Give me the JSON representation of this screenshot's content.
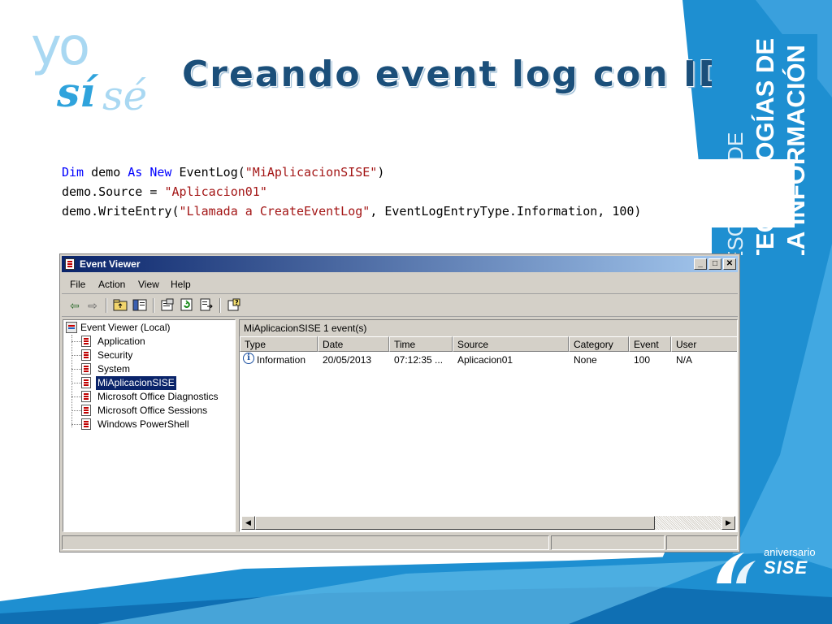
{
  "slide": {
    "title": "Creando event log con ID",
    "logo": {
      "yo": "yo",
      "si": "sí",
      "se": "sé"
    },
    "side_text": {
      "line1": "ESCUELA DE",
      "line2": "TECNOLOGÍAS DE",
      "line3": "LA INFORMACIÓN"
    },
    "anniversary": {
      "top": "aniversario",
      "bottom": "SISE"
    },
    "colors": {
      "title": "#1b4f7a",
      "accent": "#1e8fd1",
      "band_light": "#8fd0f5"
    }
  },
  "code": {
    "line1": {
      "kw1": "Dim",
      "t1": " demo ",
      "kw2": "As",
      "sp": " ",
      "kw3": "New",
      "t2": " EventLog(",
      "s1": "\"MiAplicacionSISE\"",
      "t3": ")"
    },
    "line2": {
      "t1": "demo.Source = ",
      "s1": "\"Aplicacion01\""
    },
    "line3": {
      "t1": "demo.WriteEntry(",
      "s1": "\"Llamada a CreateEventLog\"",
      "t2": ", EventLogEntryType.Information, 100)"
    }
  },
  "window": {
    "title": "Event Viewer",
    "controls": {
      "minimize": "_",
      "maximize": "□",
      "close": "✕"
    },
    "menu": [
      "File",
      "Action",
      "View",
      "Help"
    ],
    "toolbar_icons": [
      "back-icon",
      "forward-icon",
      "up-folder-icon",
      "show-tree-icon",
      "properties-icon",
      "refresh-icon",
      "export-icon",
      "help-icon"
    ],
    "tree": {
      "root": "Event Viewer (Local)",
      "items": [
        {
          "label": "Application"
        },
        {
          "label": "Security"
        },
        {
          "label": "System"
        },
        {
          "label": "MiAplicacionSISE",
          "selected": true
        },
        {
          "label": "Microsoft Office Diagnostics"
        },
        {
          "label": "Microsoft Office Sessions"
        },
        {
          "label": "Windows PowerShell"
        }
      ]
    },
    "list": {
      "log_name": "MiAplicacionSISE",
      "event_count": "1 event(s)",
      "columns": [
        "Type",
        "Date",
        "Time",
        "Source",
        "Category",
        "Event",
        "User"
      ],
      "rows": [
        {
          "type": "Information",
          "date": "20/05/2013",
          "time": "07:12:35 ...",
          "source": "Aplicacion01",
          "category": "None",
          "event": "100",
          "user": "N/A"
        }
      ]
    }
  }
}
